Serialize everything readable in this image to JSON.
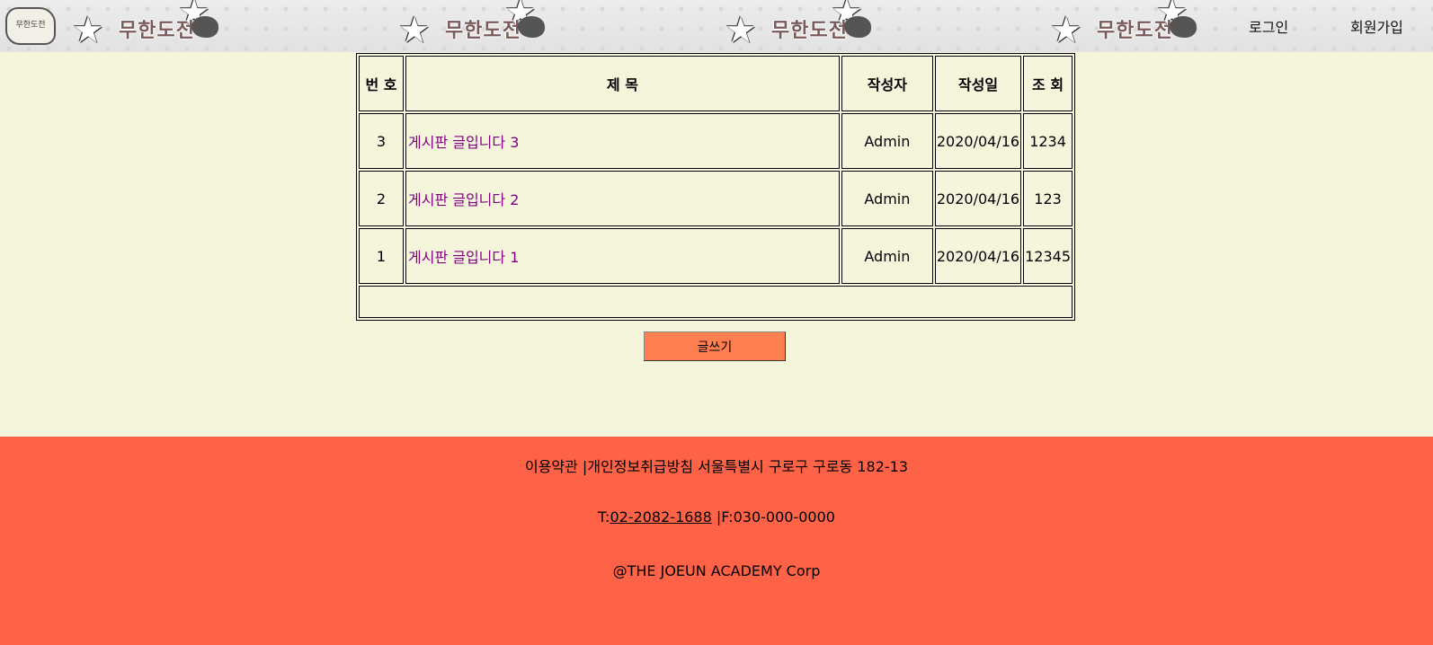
{
  "header": {
    "logo_text": "무한도전",
    "banner_title": "무한도전",
    "login_label": "로그인",
    "signup_label": "회원가입"
  },
  "board": {
    "columns": [
      "번 호",
      "제 목",
      "작성자",
      "작성일",
      "조 회"
    ],
    "rows": [
      {
        "no": "3",
        "title": "게시판 글입니다 3",
        "author": "Admin",
        "date": "2020/04/16",
        "views": "1234"
      },
      {
        "no": "2",
        "title": "게시판 글입니다 2",
        "author": "Admin",
        "date": "2020/04/16",
        "views": "123"
      },
      {
        "no": "1",
        "title": "게시판 글입니다 1",
        "author": "Admin",
        "date": "2020/04/16",
        "views": "12345"
      }
    ],
    "write_button": "글쓰기"
  },
  "footer": {
    "line1": "이용약관 |개인정보취급방침 서울특별시 구로구 구로동 182-13",
    "tel_prefix": "T:",
    "tel": "02-2082-1688",
    "fax": " |F:030-000-0000",
    "copyright": "@THE JOEUN ACADEMY Corp"
  },
  "colors": {
    "page_bg": "#f5f5dc",
    "footer_bg": "#ff6347",
    "button_bg": "#ff7f50",
    "link": "#800080"
  }
}
